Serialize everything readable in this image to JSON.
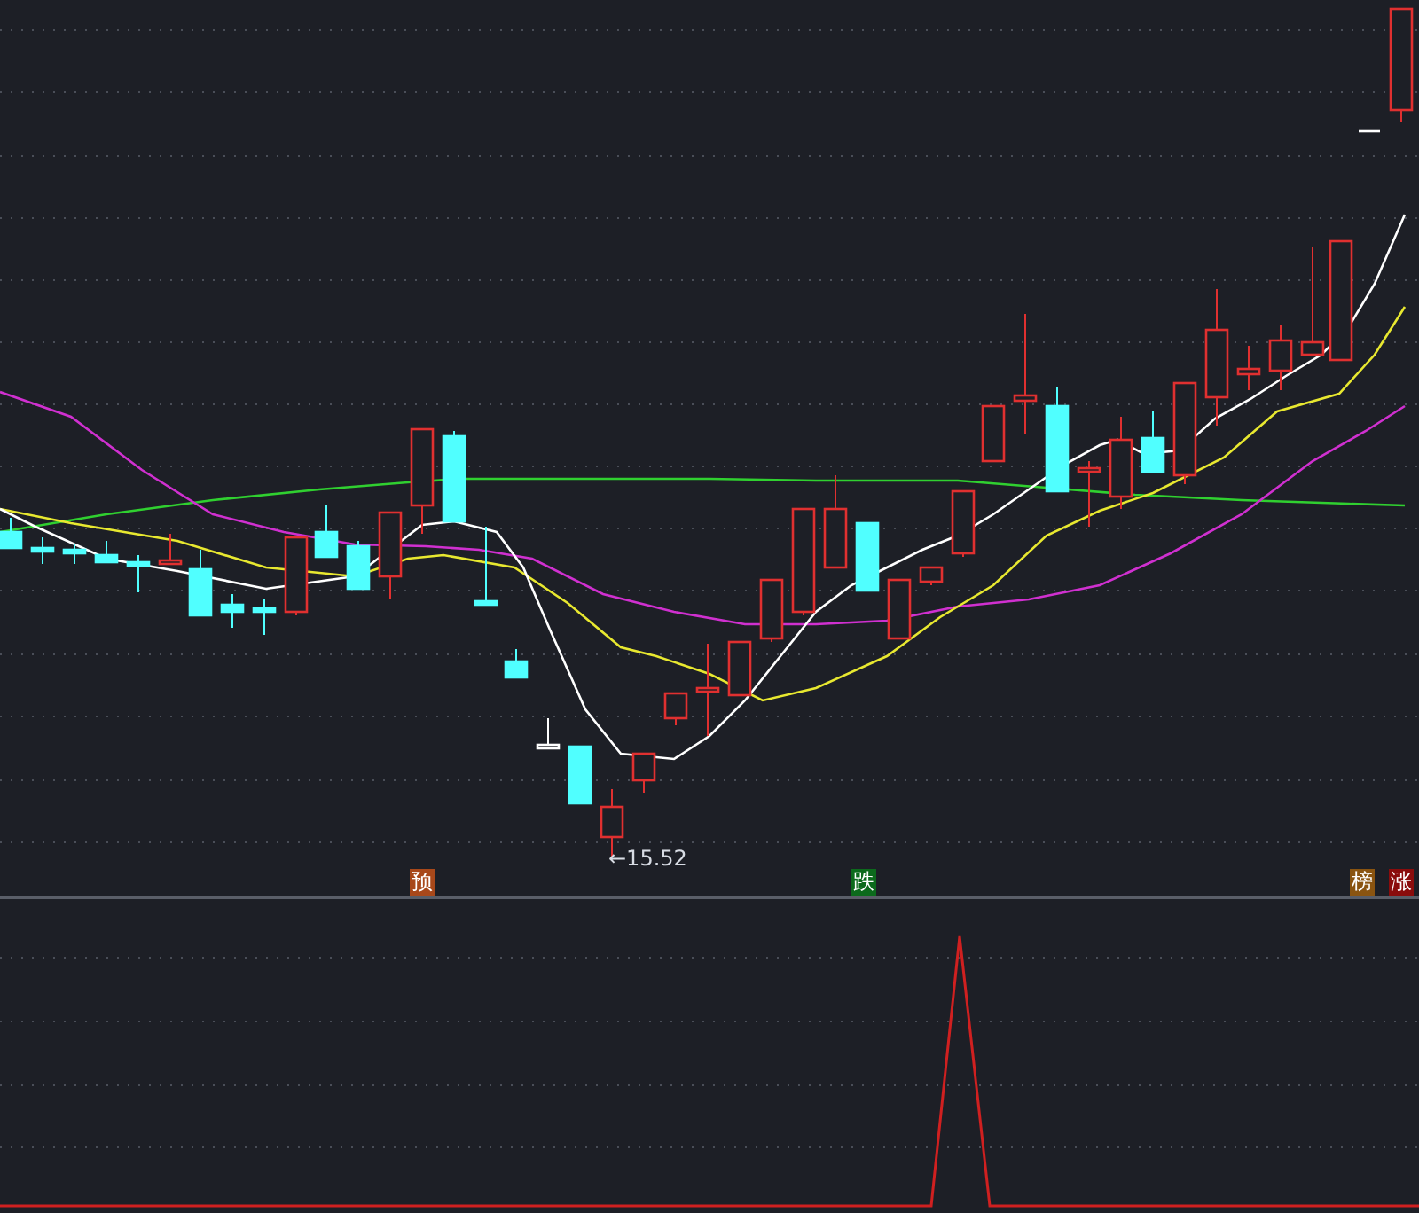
{
  "low_price_label": "←15.52",
  "signal_markers": [
    {
      "text": "预",
      "color": "#a8481a"
    },
    {
      "text": "跌",
      "color": "#0c6a1c"
    },
    {
      "text": "榜",
      "color": "#8a5410"
    },
    {
      "text": "涨",
      "color": "#8a0c0c"
    }
  ]
}
